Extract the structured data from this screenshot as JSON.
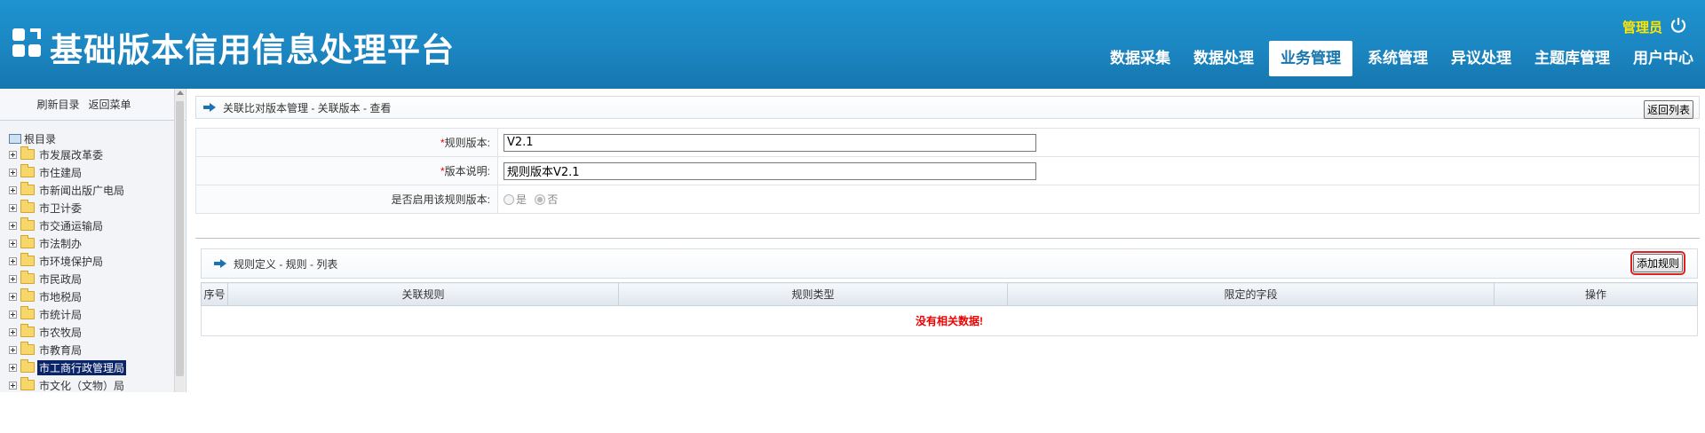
{
  "header": {
    "app_title": "基础版本信用信息处理平台",
    "user_label": "管理员",
    "nav": [
      {
        "label": "数据采集",
        "active": false
      },
      {
        "label": "数据处理",
        "active": false
      },
      {
        "label": "业务管理",
        "active": true
      },
      {
        "label": "系统管理",
        "active": false
      },
      {
        "label": "异议处理",
        "active": false
      },
      {
        "label": "主题库管理",
        "active": false
      },
      {
        "label": "用户中心",
        "active": false
      }
    ]
  },
  "sidebar": {
    "refresh_label": "刷新目录",
    "back_menu_label": "返回菜单",
    "root_label": "根目录",
    "items": [
      {
        "label": "市发展改革委"
      },
      {
        "label": "市住建局"
      },
      {
        "label": "市新闻出版广电局"
      },
      {
        "label": "市卫计委"
      },
      {
        "label": "市交通运输局"
      },
      {
        "label": "市法制办"
      },
      {
        "label": "市环境保护局"
      },
      {
        "label": "市民政局"
      },
      {
        "label": "市地税局"
      },
      {
        "label": "市统计局"
      },
      {
        "label": "市农牧局"
      },
      {
        "label": "市教育局"
      },
      {
        "label": "市工商行政管理局"
      },
      {
        "label": "市文化（文物）局"
      }
    ],
    "selected_index": 12
  },
  "breadcrumb": {
    "text": "关联比对版本管理 - 关联版本 - 查看",
    "back_button": "返回列表"
  },
  "form": {
    "rule_version_label": "规则版本:",
    "rule_version_value": "V2.1",
    "version_desc_label": "版本说明:",
    "version_desc_value": "规则版本V2.1",
    "enable_label": "是否启用该规则版本:",
    "option_yes": "是",
    "option_no": "否",
    "selected": "否",
    "required_mark": "*"
  },
  "rules": {
    "title": "规则定义 - 规则 - 列表",
    "add_button": "添加规则",
    "columns": [
      "序号",
      "关联规则",
      "规则类型",
      "限定的字段",
      "操作"
    ],
    "empty_message": "没有相关数据!"
  },
  "colors": {
    "header_blue": "#1b86c2",
    "admin_yellow": "#ffe600",
    "error_red": "#e00000"
  }
}
